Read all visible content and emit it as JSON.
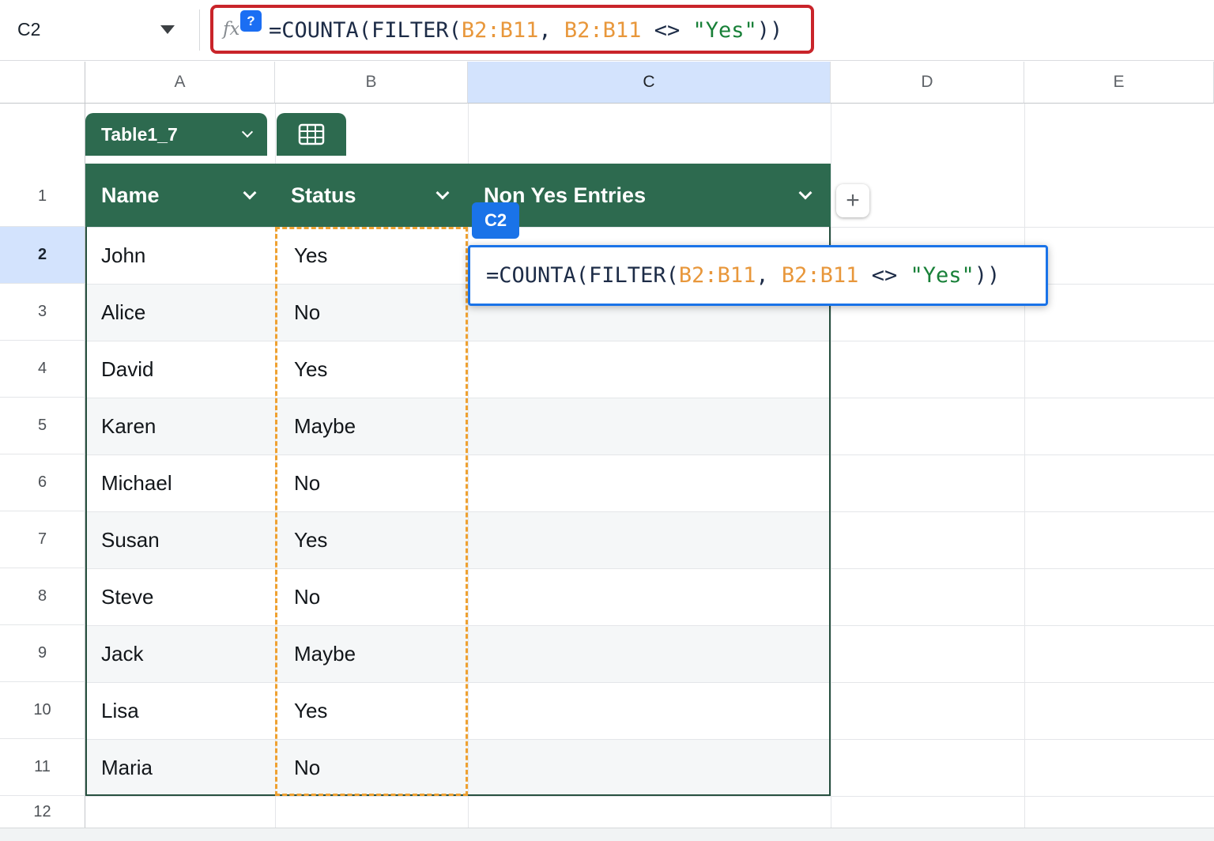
{
  "formula_bar": {
    "cell_ref": "C2",
    "fx_label": "fx",
    "help_badge": "?",
    "formula_segments": [
      {
        "text": "=COUNTA(FILTER(",
        "type": "default"
      },
      {
        "text": "B2:B11",
        "type": "range"
      },
      {
        "text": ", ",
        "type": "default"
      },
      {
        "text": "B2:B11",
        "type": "range"
      },
      {
        "text": " <> ",
        "type": "default"
      },
      {
        "text": "\"Yes\"",
        "type": "string"
      },
      {
        "text": "))",
        "type": "default"
      }
    ]
  },
  "grid": {
    "column_letters": [
      "A",
      "B",
      "C",
      "D",
      "E"
    ],
    "row_numbers": [
      "1",
      "2",
      "3",
      "4",
      "5",
      "6",
      "7",
      "8",
      "9",
      "10",
      "11",
      "12"
    ],
    "selected_cell": "C2"
  },
  "table": {
    "name": "Table1_7",
    "headers": [
      {
        "label": "Name"
      },
      {
        "label": "Status"
      },
      {
        "label": "Non Yes Entries"
      }
    ],
    "add_column_label": "+",
    "rows": [
      {
        "name": "John",
        "status": "Yes"
      },
      {
        "name": "Alice",
        "status": "No"
      },
      {
        "name": "David",
        "status": "Yes"
      },
      {
        "name": "Karen",
        "status": "Maybe"
      },
      {
        "name": "Michael",
        "status": "No"
      },
      {
        "name": "Susan",
        "status": "Yes"
      },
      {
        "name": "Steve",
        "status": "No"
      },
      {
        "name": "Jack",
        "status": "Maybe"
      },
      {
        "name": "Lisa",
        "status": "Yes"
      },
      {
        "name": "Maria",
        "status": "No"
      }
    ]
  },
  "cell_editor": {
    "cell_label": "C2",
    "formula_segments": [
      {
        "text": "=COUNTA(FILTER(",
        "type": "default"
      },
      {
        "text": "B2:B11",
        "type": "range"
      },
      {
        "text": ", ",
        "type": "default"
      },
      {
        "text": "B2:B11",
        "type": "range"
      },
      {
        "text": " <> ",
        "type": "default"
      },
      {
        "text": "\"Yes\"",
        "type": "string"
      },
      {
        "text": "))",
        "type": "default"
      }
    ]
  },
  "colors": {
    "table_header_green": "#2d6a4f",
    "selection_blue": "#1a73e8",
    "selection_tint": "#d3e3fd",
    "range_reference_orange": "#e8973b",
    "string_literal_green": "#188038",
    "formula_text_dark": "#1d2c47",
    "annotation_red": "#c9242a",
    "marquee_orange": "#efa131"
  }
}
